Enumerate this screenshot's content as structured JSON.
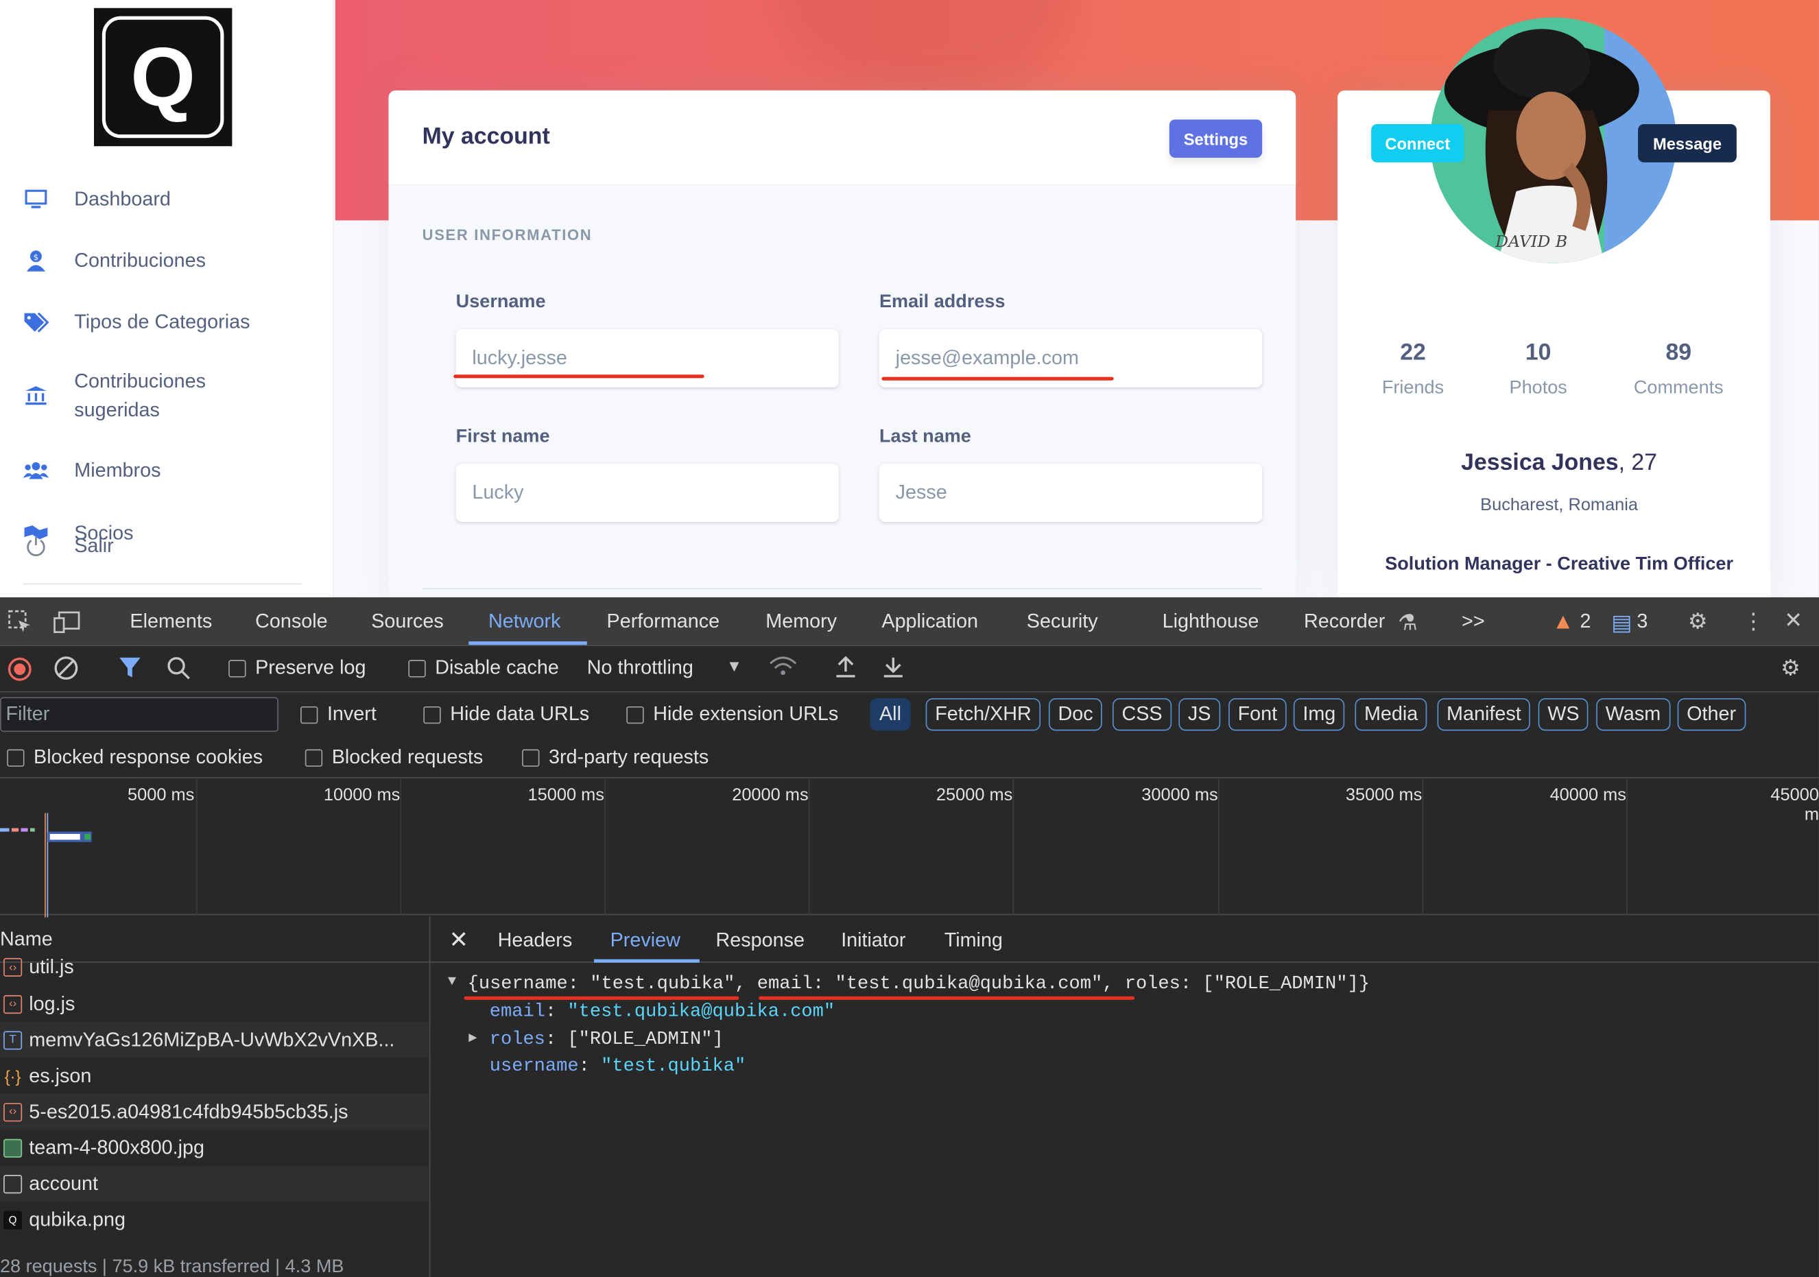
{
  "sidebar": {
    "logo_letter": "Q",
    "items": [
      {
        "label": "Dashboard",
        "icon": "monitor-icon"
      },
      {
        "label": "Contribuciones",
        "icon": "money-user-icon"
      },
      {
        "label": "Tipos de Categorias",
        "icon": "tags-icon"
      },
      {
        "label": "Contribuciones sugeridas",
        "icon": "bank-icon"
      },
      {
        "label": "Miembros",
        "icon": "users-icon"
      },
      {
        "label": "Socios",
        "icon": "handshake-icon"
      },
      {
        "label": "Salir",
        "icon": "power-icon"
      }
    ]
  },
  "account": {
    "title": "My account",
    "settings_label": "Settings",
    "section_heading": "USER INFORMATION",
    "fields": {
      "username": {
        "label": "Username",
        "value": "lucky.jesse"
      },
      "email": {
        "label": "Email address",
        "placeholder": "jesse@example.com"
      },
      "first_name": {
        "label": "First name",
        "value": "Lucky"
      },
      "last_name": {
        "label": "Last name",
        "value": "Jesse"
      }
    }
  },
  "profile": {
    "connect_label": "Connect",
    "message_label": "Message",
    "stats": [
      {
        "value": "22",
        "label": "Friends"
      },
      {
        "value": "10",
        "label": "Photos"
      },
      {
        "value": "89",
        "label": "Comments"
      }
    ],
    "name": "Jessica Jones",
    "age": ", 27",
    "location": "Bucharest, Romania",
    "job": "Solution Manager - Creative Tim Officer"
  },
  "devtools": {
    "tabs": [
      "Elements",
      "Console",
      "Sources",
      "Network",
      "Performance",
      "Memory",
      "Application",
      "Security",
      "Lighthouse",
      "Recorder"
    ],
    "active_tab": "Network",
    "more_tabs": ">>",
    "warnings_count": "2",
    "messages_count": "3",
    "toolbar": {
      "preserve_log": "Preserve log",
      "disable_cache": "Disable cache",
      "throttling": "No throttling"
    },
    "filter": {
      "placeholder": "Filter",
      "invert": "Invert",
      "hide_data_urls": "Hide data URLs",
      "hide_extension_urls": "Hide extension URLs",
      "types": [
        "All",
        "Fetch/XHR",
        "Doc",
        "CSS",
        "JS",
        "Font",
        "Img",
        "Media",
        "Manifest",
        "WS",
        "Wasm",
        "Other"
      ],
      "active_type": "All"
    },
    "blocked": {
      "response_cookies": "Blocked response cookies",
      "requests": "Blocked requests",
      "third_party": "3rd-party requests"
    },
    "timeline_ticks": [
      "5000 ms",
      "10000 ms",
      "15000 ms",
      "20000 ms",
      "25000 ms",
      "30000 ms",
      "35000 ms",
      "40000 ms",
      "45000 m"
    ],
    "name_header": "Name",
    "requests": [
      {
        "name": "util.js",
        "type": "script"
      },
      {
        "name": "log.js",
        "type": "script"
      },
      {
        "name": "memvYaGs126MiZpBA-UvWbX2vVnXB...",
        "type": "text"
      },
      {
        "name": "es.json",
        "type": "json"
      },
      {
        "name": "5-es2015.a04981c4fdb945b5cb35.js",
        "type": "script"
      },
      {
        "name": "team-4-800x800.jpg",
        "type": "image"
      },
      {
        "name": "account",
        "type": "doc"
      },
      {
        "name": "qubika.png",
        "type": "image"
      }
    ],
    "status_bar": "28 requests | 75.9 kB transferred | 4.3 MB",
    "detail_tabs": [
      "Headers",
      "Preview",
      "Response",
      "Initiator",
      "Timing"
    ],
    "active_detail_tab": "Preview",
    "preview": {
      "summary_line": "{username: \"test.qubika\", email: \"test.qubika@qubika.com\", roles: [\"ROLE_ADMIN\"]}",
      "email_key": "email",
      "email_value": "\"test.qubika@qubika.com\"",
      "roles_key": "roles",
      "roles_value": "[\"ROLE_ADMIN\"]",
      "username_key": "username",
      "username_value": "\"test.qubika\""
    }
  }
}
